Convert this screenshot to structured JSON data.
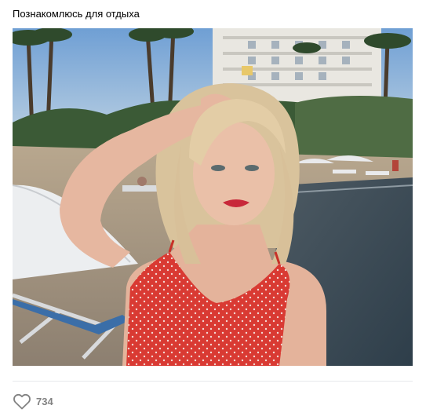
{
  "post": {
    "text": "Познакомлюсь для отдыха",
    "image_subject": "beach-portrait-photo"
  },
  "actions": {
    "like_count": "734",
    "like_icon": "heart-outline-icon"
  },
  "colors": {
    "like_icon": "#828282",
    "divider": "#e7e8ec",
    "dress": "#d93a33"
  }
}
